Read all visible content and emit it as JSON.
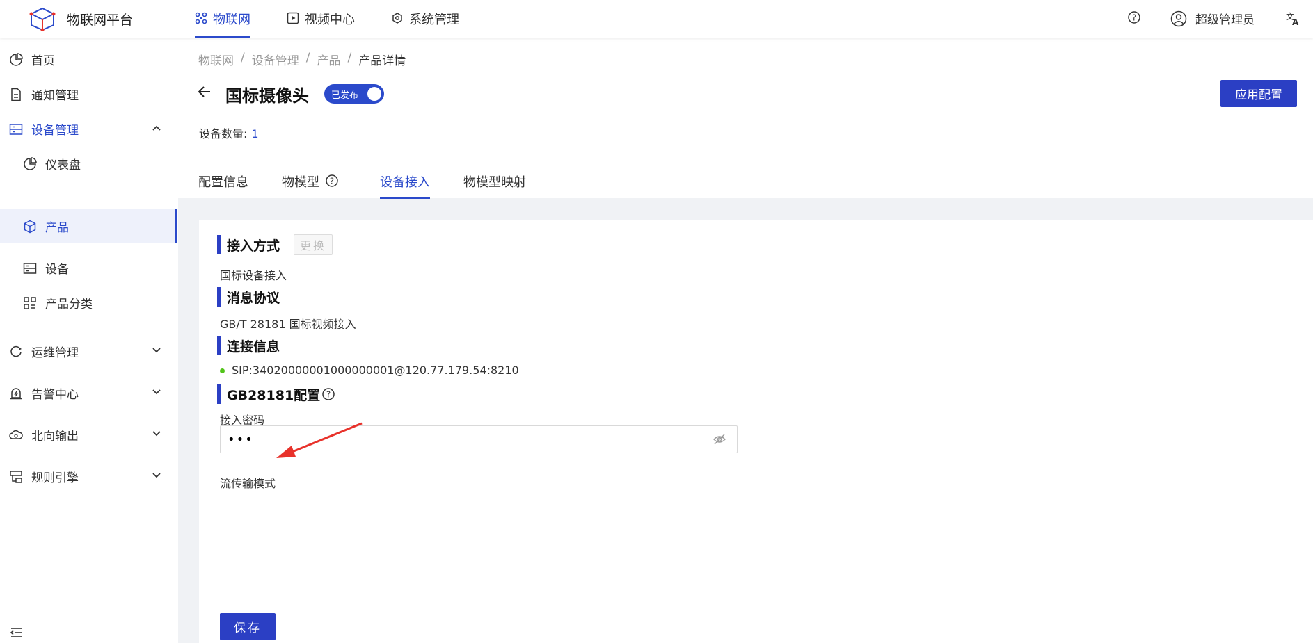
{
  "topbar": {
    "brand": "物联网平台",
    "nav": [
      {
        "label": "物联网",
        "icon": "iot-icon",
        "active": true
      },
      {
        "label": "视频中心",
        "icon": "video-icon",
        "active": false
      },
      {
        "label": "系统管理",
        "icon": "system-icon",
        "active": false
      }
    ],
    "user_name": "超级管理员"
  },
  "sidebar": {
    "items": [
      {
        "label": "首页",
        "icon": "pie-chart-icon"
      },
      {
        "label": "通知管理",
        "icon": "document-icon"
      },
      {
        "label": "设备管理",
        "icon": "device-list-icon",
        "open": true
      },
      {
        "label": "仪表盘",
        "icon": "pie-chart-icon",
        "sub": true
      },
      {
        "label": "产品",
        "icon": "cube-icon",
        "sub": true,
        "selected": true
      },
      {
        "label": "设备",
        "icon": "device-list-icon",
        "sub": true
      },
      {
        "label": "产品分类",
        "icon": "category-icon",
        "sub": true
      },
      {
        "label": "运维管理",
        "icon": "ops-icon"
      },
      {
        "label": "告警中心",
        "icon": "alarm-icon"
      },
      {
        "label": "北向输出",
        "icon": "cloud-icon"
      },
      {
        "label": "规则引擎",
        "icon": "rule-icon"
      }
    ]
  },
  "breadcrumb": [
    "物联网",
    "设备管理",
    "产品",
    "产品详情"
  ],
  "product": {
    "name": "国标摄像头",
    "status": "已发布",
    "device_count_label": "设备数量:",
    "device_count": "1",
    "apply_button": "应用配置"
  },
  "tabs": [
    {
      "label": "配置信息",
      "active": false
    },
    {
      "label": "物模型",
      "active": false,
      "help": true
    },
    {
      "label": "设备接入",
      "active": true
    },
    {
      "label": "物模型映射",
      "active": false
    }
  ],
  "access": {
    "method_title": "接入方式",
    "change_button": "更换",
    "method_value": "国标设备接入",
    "protocol_title": "消息协议",
    "protocol_value": "GB/T 28181 国标视频接入",
    "connection_title": "连接信息",
    "connection_value": "SIP:34020000001000000001@120.77.179.54:8210",
    "gb_title": "GB28181配置",
    "password_label": "接入密码",
    "password_value": "•••",
    "stream_mode_label": "流传输模式",
    "save_button": "保存"
  },
  "colors": {
    "primary": "#2b3fc4",
    "accent": "#2b4acb",
    "online": "#52c41a",
    "annotation": "#e8322b"
  }
}
